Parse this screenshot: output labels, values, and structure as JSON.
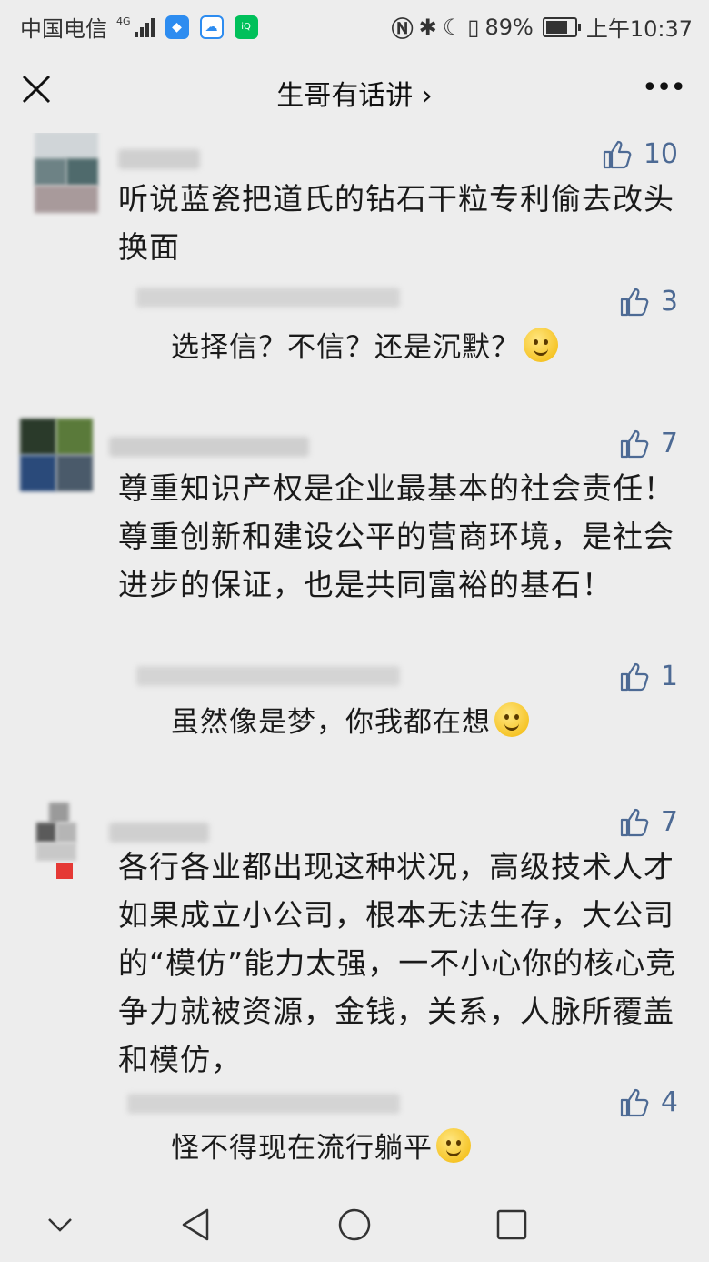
{
  "status_bar": {
    "carrier": "中国电信",
    "network": "4G",
    "battery_pct": "89%",
    "battery_level": 0.89,
    "time": "上午10:37"
  },
  "header": {
    "title": "生哥有话讲 ›"
  },
  "comments": [
    {
      "likes": "10",
      "text": "听说蓝瓷把道氏的钻石干粒专利偷去改头换面",
      "reply": {
        "likes": "3",
        "text": "选择信？不信？还是沉默？"
      }
    },
    {
      "likes": "7",
      "text": "尊重知识产权是企业最基本的社会责任！尊重创新和建设公平的营商环境，是社会进步的保证，也是共同富裕的基石！",
      "reply": {
        "likes": "1",
        "text": "虽然像是梦，你我都在想"
      }
    },
    {
      "likes": "7",
      "text": "各行各业都出现这种状况，高级技术人才如果成立小公司，根本无法生存，大公司的“模仿”能力太强，一不小心你的核心竞争力就被资源，金钱，关系，人脉所覆盖和模仿，",
      "reply": {
        "likes": "4",
        "text": "怪不得现在流行躺平"
      }
    }
  ],
  "colors": {
    "background": "#ededed",
    "like_blue": "#4d6a94",
    "text": "#1a1a1a"
  },
  "icons": [
    "close-icon",
    "more-icon",
    "thumb-up-icon",
    "back-icon",
    "home-icon",
    "recents-icon",
    "collapse-icon"
  ]
}
